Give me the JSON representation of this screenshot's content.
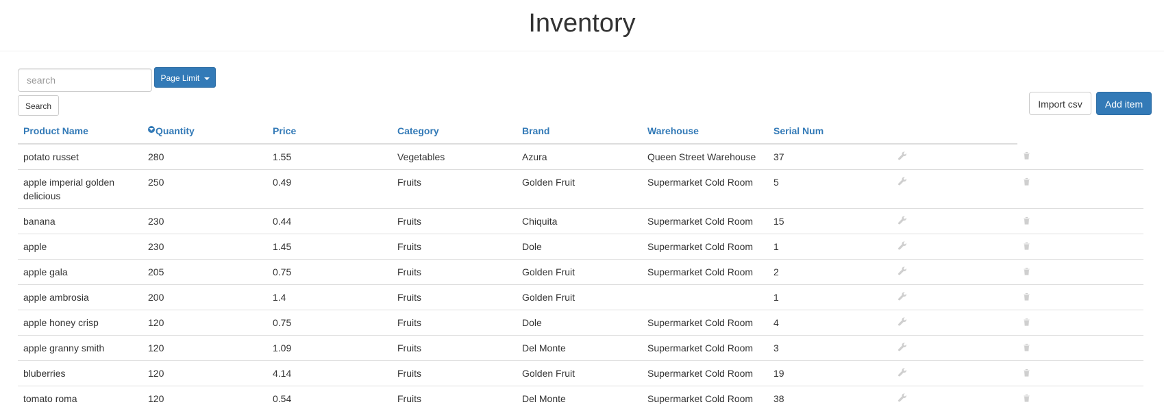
{
  "header": {
    "title": "Inventory"
  },
  "controls": {
    "search_placeholder": "search",
    "page_limit_label": "Page Limit",
    "search_button": "Search",
    "import_button": "Import csv",
    "add_button": "Add item"
  },
  "table": {
    "columns": [
      "Product Name",
      "Quantity",
      "Price",
      "Category",
      "Brand",
      "Warehouse",
      "Serial Num"
    ],
    "sorted_column": "Quantity",
    "rows": [
      {
        "name": "potato russet",
        "quantity": "280",
        "price": "1.55",
        "category": "Vegetables",
        "brand": "Azura",
        "warehouse": "Queen Street Warehouse",
        "serial": "37"
      },
      {
        "name": "apple imperial golden delicious",
        "quantity": "250",
        "price": "0.49",
        "category": "Fruits",
        "brand": "Golden Fruit",
        "warehouse": "Supermarket Cold Room",
        "serial": "5"
      },
      {
        "name": "banana",
        "quantity": "230",
        "price": "0.44",
        "category": "Fruits",
        "brand": "Chiquita",
        "warehouse": "Supermarket Cold Room",
        "serial": "15"
      },
      {
        "name": "apple",
        "quantity": "230",
        "price": "1.45",
        "category": "Fruits",
        "brand": "Dole",
        "warehouse": "Supermarket Cold Room",
        "serial": "1"
      },
      {
        "name": "apple gala",
        "quantity": "205",
        "price": "0.75",
        "category": "Fruits",
        "brand": "Golden Fruit",
        "warehouse": "Supermarket Cold Room",
        "serial": "2"
      },
      {
        "name": "apple ambrosia",
        "quantity": "200",
        "price": "1.4",
        "category": "Fruits",
        "brand": "Golden Fruit",
        "warehouse": "",
        "serial": "1"
      },
      {
        "name": "apple honey crisp",
        "quantity": "120",
        "price": "0.75",
        "category": "Fruits",
        "brand": "Dole",
        "warehouse": "Supermarket Cold Room",
        "serial": "4"
      },
      {
        "name": "apple granny smith",
        "quantity": "120",
        "price": "1.09",
        "category": "Fruits",
        "brand": "Del Monte",
        "warehouse": "Supermarket Cold Room",
        "serial": "3"
      },
      {
        "name": "bluberries",
        "quantity": "120",
        "price": "4.14",
        "category": "Fruits",
        "brand": "Golden Fruit",
        "warehouse": "Supermarket Cold Room",
        "serial": "19"
      },
      {
        "name": "tomato roma",
        "quantity": "120",
        "price": "0.54",
        "category": "Fruits",
        "brand": "Del Monte",
        "warehouse": "Supermarket Cold Room",
        "serial": "38"
      }
    ]
  },
  "icons": {
    "edit": "wrench-icon",
    "delete": "trash-icon",
    "sort": "sort-desc-icon"
  },
  "colors": {
    "accent": "#337ab7",
    "text": "#333333",
    "border": "#dddddd"
  }
}
